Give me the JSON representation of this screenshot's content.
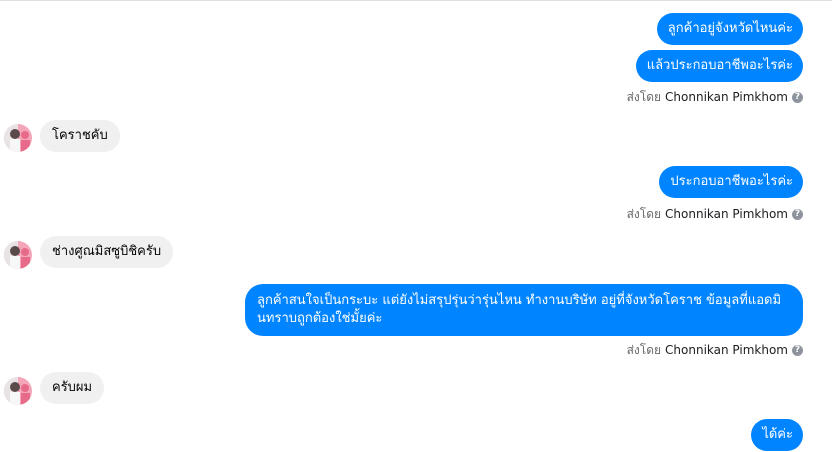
{
  "messages": {
    "m1": "ลูกค้าอยู่จังหวัดไหนค่ะ",
    "m2": "แล้วประกอบอาชีพอะไรค่ะ",
    "m3": "โคราชคับ",
    "m4": "ประกอบอาชีพอะไรค่ะ",
    "m5": "ช่างศูณมิสซูบิชิครับ",
    "m6": "ลูกค้าสนใจเป็นกระบะ แต่ยังไม่สรุปรุ่นว่ารุ่นไหน ทำงานบริษัท อยู่ที่จังหวัดโคราช ข้อมูลที่แอดมินทราบถูกต้องใช่มั้ยค่ะ",
    "m7": "ครับผม",
    "m8": "ได้ค่ะ"
  },
  "sent_by": {
    "prefix": "ส่งโดย",
    "name": "Chonnikan Pimkhom",
    "info_icon": "info-icon"
  },
  "colors": {
    "outgoing_bubble": "#0084ff",
    "incoming_bubble": "#f0f0f0"
  }
}
